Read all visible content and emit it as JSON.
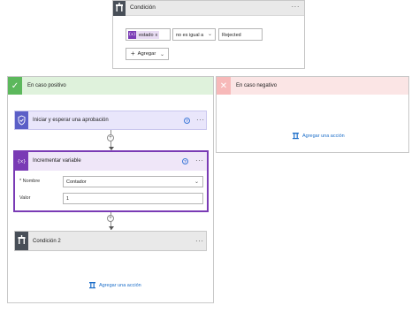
{
  "condition": {
    "title": "Condición",
    "token_label": "estado",
    "token_remove": "x",
    "token_icon_text": "{x}",
    "operator": "no es igual a",
    "value": "Rejected",
    "add_button": "Agregar",
    "icons": {
      "header": "condition-icon",
      "more": "more-options-icon",
      "add": "plus-icon",
      "dropdown": "chevron-down-icon"
    }
  },
  "positive_branch": {
    "title": "En caso positivo",
    "icon": "check-icon",
    "color": "#5cb85c",
    "approval": {
      "title": "Iniciar y esperar una aprobación",
      "icon": "approval-icon"
    },
    "increment_variable": {
      "title": "Incrementar variable",
      "icon_text": "{x}",
      "name_label": "* Nombre",
      "name_value": "Contador",
      "value_label": "Valor",
      "value_value": "1",
      "color": "#7a3bb5"
    },
    "condition2": {
      "title": "Condición 2"
    },
    "add_action": "Agregar una acción"
  },
  "negative_branch": {
    "title": "En caso negativo",
    "icon": "close-icon",
    "color": "#f7b9b9",
    "add_action": "Agregar una acción"
  },
  "connectors": {
    "plus": "+",
    "help": "?",
    "more": "···",
    "check_glyph": "✓",
    "close_glyph": "✕",
    "chevron": "⌄",
    "add_glyph": "+"
  }
}
